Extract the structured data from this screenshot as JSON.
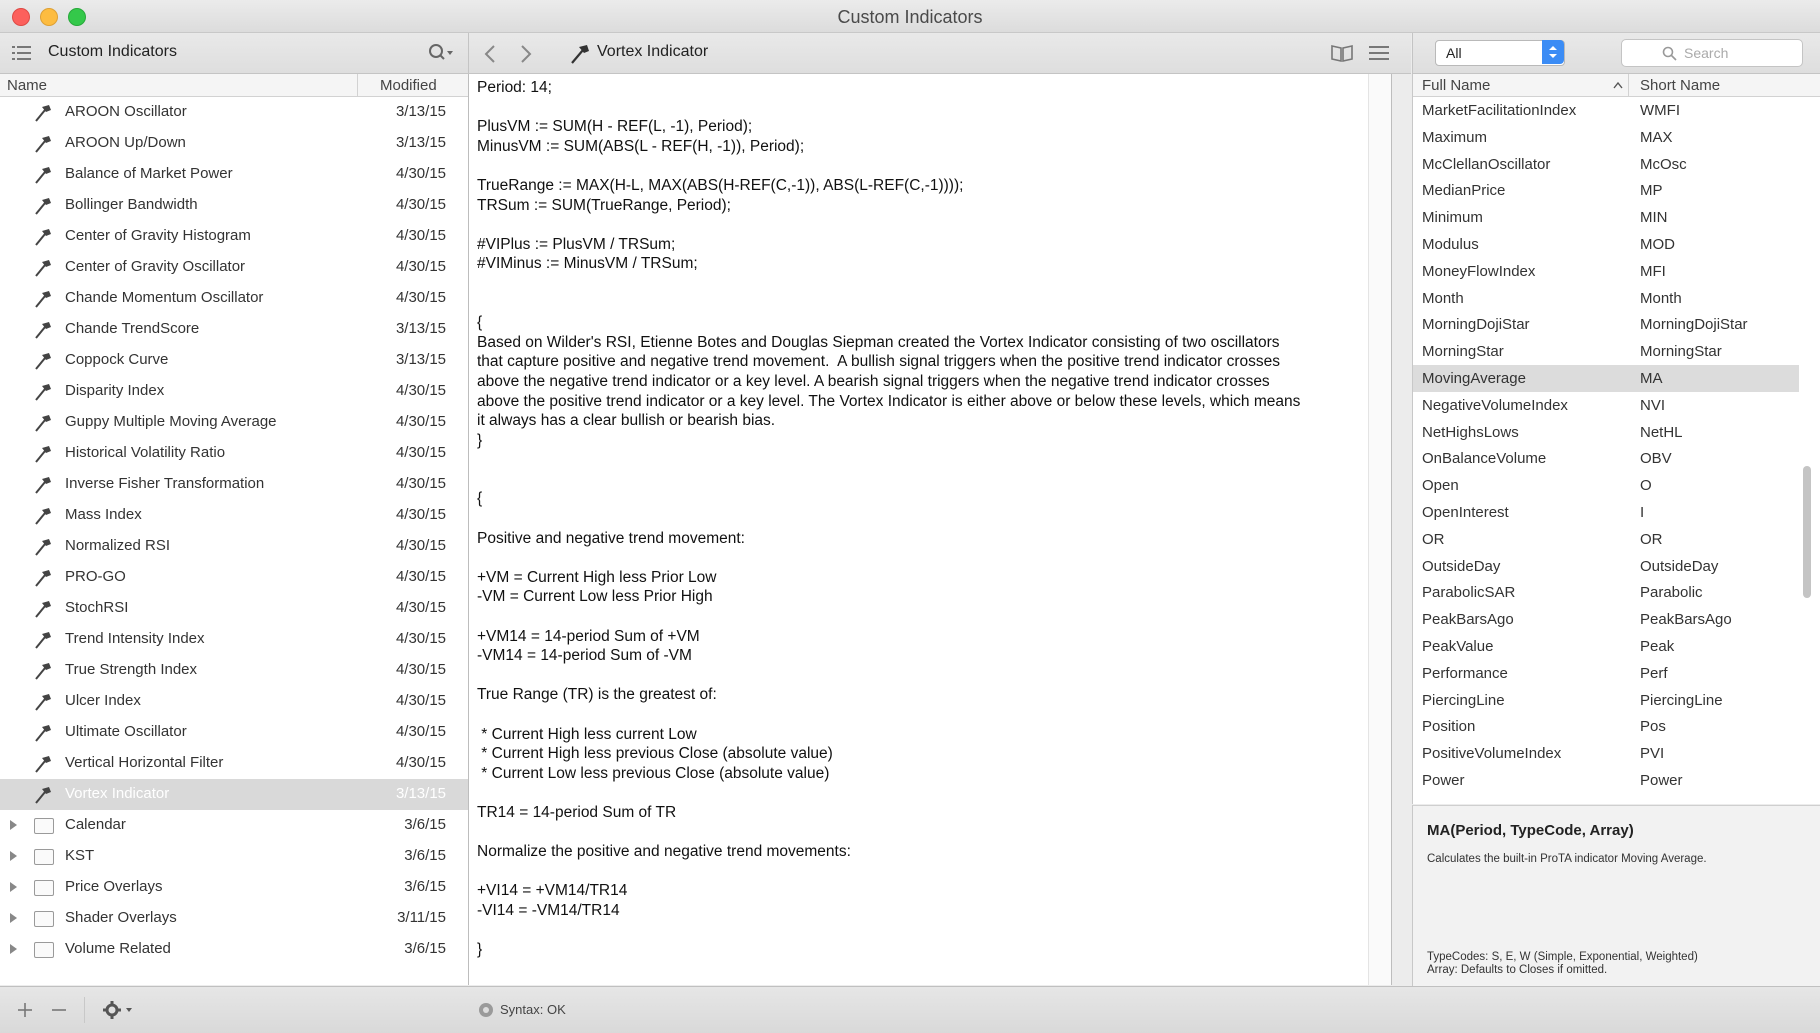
{
  "window": {
    "title": "Custom Indicators"
  },
  "left_toolbar": {
    "title": "Custom Indicators"
  },
  "mid_toolbar": {
    "doc_title": "Vortex Indicator"
  },
  "right_toolbar": {
    "filter_value": "All",
    "search_placeholder": "Search"
  },
  "left_table": {
    "col_name": "Name",
    "col_modified": "Modified",
    "rows": [
      {
        "name": "AROON Oscillator",
        "date": "3/13/15"
      },
      {
        "name": "AROON Up/Down",
        "date": "3/13/15"
      },
      {
        "name": "Balance of Market Power",
        "date": "4/30/15"
      },
      {
        "name": "Bollinger Bandwidth",
        "date": "4/30/15"
      },
      {
        "name": "Center of Gravity Histogram",
        "date": "4/30/15"
      },
      {
        "name": "Center of Gravity Oscillator",
        "date": "4/30/15"
      },
      {
        "name": "Chande Momentum Oscillator",
        "date": "4/30/15"
      },
      {
        "name": "Chande TrendScore",
        "date": "3/13/15"
      },
      {
        "name": "Coppock Curve",
        "date": "3/13/15"
      },
      {
        "name": "Disparity Index",
        "date": "4/30/15"
      },
      {
        "name": "Guppy Multiple Moving Average",
        "date": "4/30/15"
      },
      {
        "name": "Historical Volatility Ratio",
        "date": "4/30/15"
      },
      {
        "name": "Inverse Fisher Transformation",
        "date": "4/30/15"
      },
      {
        "name": "Mass Index",
        "date": "4/30/15"
      },
      {
        "name": "Normalized RSI",
        "date": "4/30/15"
      },
      {
        "name": "PRO-GO",
        "date": "4/30/15"
      },
      {
        "name": "StochRSI",
        "date": "4/30/15"
      },
      {
        "name": "Trend Intensity Index",
        "date": "4/30/15"
      },
      {
        "name": "True Strength Index",
        "date": "4/30/15"
      },
      {
        "name": "Ulcer Index",
        "date": "4/30/15"
      },
      {
        "name": "Ultimate Oscillator",
        "date": "4/30/15"
      },
      {
        "name": "Vertical Horizontal Filter",
        "date": "4/30/15"
      },
      {
        "name": "Vortex Indicator",
        "date": "3/13/15"
      }
    ],
    "folders": [
      {
        "name": "Calendar",
        "date": "3/6/15"
      },
      {
        "name": "KST",
        "date": "3/6/15"
      },
      {
        "name": "Price Overlays",
        "date": "3/6/15"
      },
      {
        "name": "Shader Overlays",
        "date": "3/11/15"
      },
      {
        "name": "Volume Related",
        "date": "3/6/15"
      }
    ]
  },
  "editor": {
    "code": "Period: 14;\n\nPlusVM := SUM(H - REF(L, -1), Period);\nMinusVM := SUM(ABS(L - REF(H, -1)), Period);\n\nTrueRange := MAX(H-L, MAX(ABS(H-REF(C,-1)), ABS(L-REF(C,-1))));\nTRSum := SUM(TrueRange, Period);\n\n#VIPlus := PlusVM / TRSum;\n#VIMinus := MinusVM / TRSum;\n\n\n{\nBased on Wilder's RSI, Etienne Botes and Douglas Siepman created the Vortex Indicator consisting of two oscillators\nthat capture positive and negative trend movement.  A bullish signal triggers when the positive trend indicator crosses\nabove the negative trend indicator or a key level. A bearish signal triggers when the negative trend indicator crosses\nabove the positive trend indicator or a key level. The Vortex Indicator is either above or below these levels, which means\nit always has a clear bullish or bearish bias.\n}\n\n\n{\n\nPositive and negative trend movement:\n\n+VM = Current High less Prior Low\n-VM = Current Low less Prior High\n\n+VM14 = 14-period Sum of +VM\n-VM14 = 14-period Sum of -VM\n\nTrue Range (TR) is the greatest of:\n\n * Current High less current Low\n * Current High less previous Close (absolute value)\n * Current Low less previous Close (absolute value)\n\nTR14 = 14-period Sum of TR\n\nNormalize the positive and negative trend movements:\n\n+VI14 = +VM14/TR14\n-VI14 = -VM14/TR14\n\n}"
  },
  "right_table": {
    "col_full": "Full Name",
    "col_short": "Short Name",
    "rows": [
      {
        "full": "MarketFacilitationIndex",
        "short": "WMFI"
      },
      {
        "full": "Maximum",
        "short": "MAX"
      },
      {
        "full": "McClellanOscillator",
        "short": "McOsc"
      },
      {
        "full": "MedianPrice",
        "short": "MP"
      },
      {
        "full": "Minimum",
        "short": "MIN"
      },
      {
        "full": "Modulus",
        "short": "MOD"
      },
      {
        "full": "MoneyFlowIndex",
        "short": "MFI"
      },
      {
        "full": "Month",
        "short": "Month"
      },
      {
        "full": "MorningDojiStar",
        "short": "MorningDojiStar"
      },
      {
        "full": "MorningStar",
        "short": "MorningStar"
      },
      {
        "full": "MovingAverage",
        "short": "MA"
      },
      {
        "full": "NegativeVolumeIndex",
        "short": "NVI"
      },
      {
        "full": "NetHighsLows",
        "short": "NetHL"
      },
      {
        "full": "OnBalanceVolume",
        "short": "OBV"
      },
      {
        "full": "Open",
        "short": "O"
      },
      {
        "full": "OpenInterest",
        "short": "I"
      },
      {
        "full": "OR",
        "short": "OR"
      },
      {
        "full": "OutsideDay",
        "short": "OutsideDay"
      },
      {
        "full": "ParabolicSAR",
        "short": "Parabolic"
      },
      {
        "full": "PeakBarsAgo",
        "short": "PeakBarsAgo"
      },
      {
        "full": "PeakValue",
        "short": "Peak"
      },
      {
        "full": "Performance",
        "short": "Perf"
      },
      {
        "full": "PiercingLine",
        "short": "PiercingLine"
      },
      {
        "full": "Position",
        "short": "Pos"
      },
      {
        "full": "PositiveVolumeIndex",
        "short": "PVI"
      },
      {
        "full": "Power",
        "short": "Power"
      }
    ]
  },
  "detail": {
    "signature": "MA(Period, TypeCode, Array)",
    "description": "Calculates the built-in ProTA indicator Moving Average.",
    "typecodes": "TypeCodes:  S,  E,  W  (Simple, Exponential, Weighted)",
    "array": "Array:  Defaults to Closes if omitted."
  },
  "status": {
    "syntax": "Syntax: OK"
  }
}
